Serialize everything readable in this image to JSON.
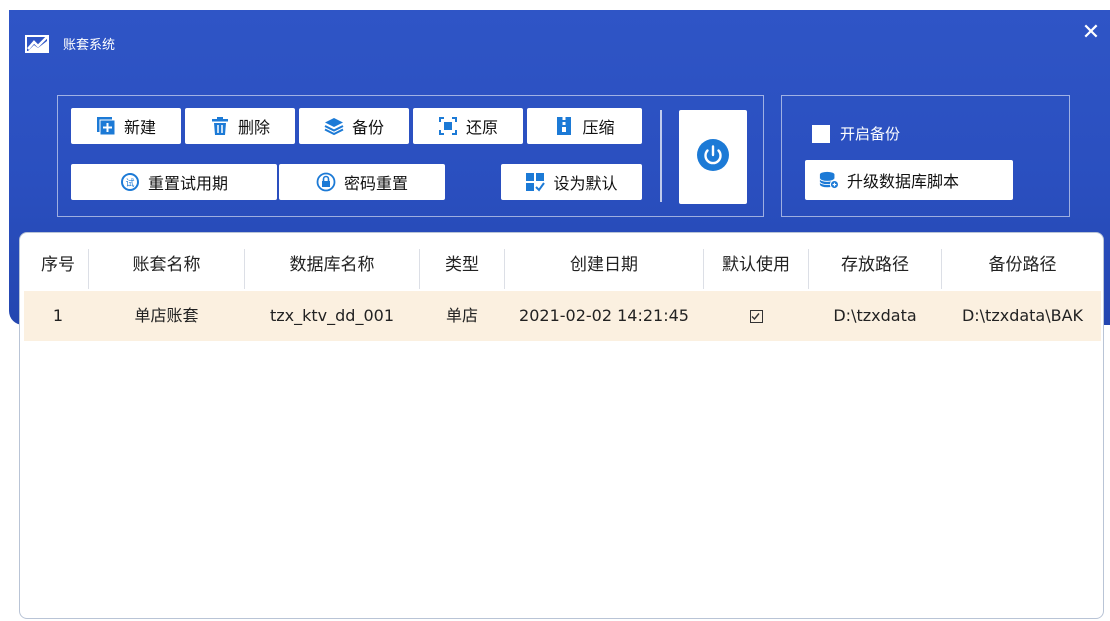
{
  "window": {
    "title": "账套系统",
    "close_glyph": "✕"
  },
  "toolbar": {
    "new_label": "新建",
    "delete_label": "删除",
    "backup_label": "备份",
    "restore_label": "还原",
    "compress_label": "压缩",
    "reset_trial_label": "重置试用期",
    "reset_password_label": "密码重置",
    "set_default_label": "设为默认"
  },
  "options": {
    "enable_backup_label": "开启备份",
    "enable_backup_checked": false,
    "upgrade_script_label": "升级数据库脚本"
  },
  "table": {
    "columns": [
      "序号",
      "账套名称",
      "数据库名称",
      "类型",
      "创建日期",
      "默认使用",
      "存放路径",
      "备份路径"
    ],
    "rows": [
      {
        "index": "1",
        "name": "单店账套",
        "db_name": "tzx_ktv_dd_001",
        "type": "单店",
        "created": "2021-02-02 14:21:45",
        "default": true,
        "storage_path": "D:\\tzxdata",
        "backup_path": "D:\\tzxdata\\BAK"
      }
    ]
  },
  "colors": {
    "header_blue": "#2f55c6",
    "row_highlight": "#fbf0e0",
    "accent": "#1c7ad6"
  }
}
